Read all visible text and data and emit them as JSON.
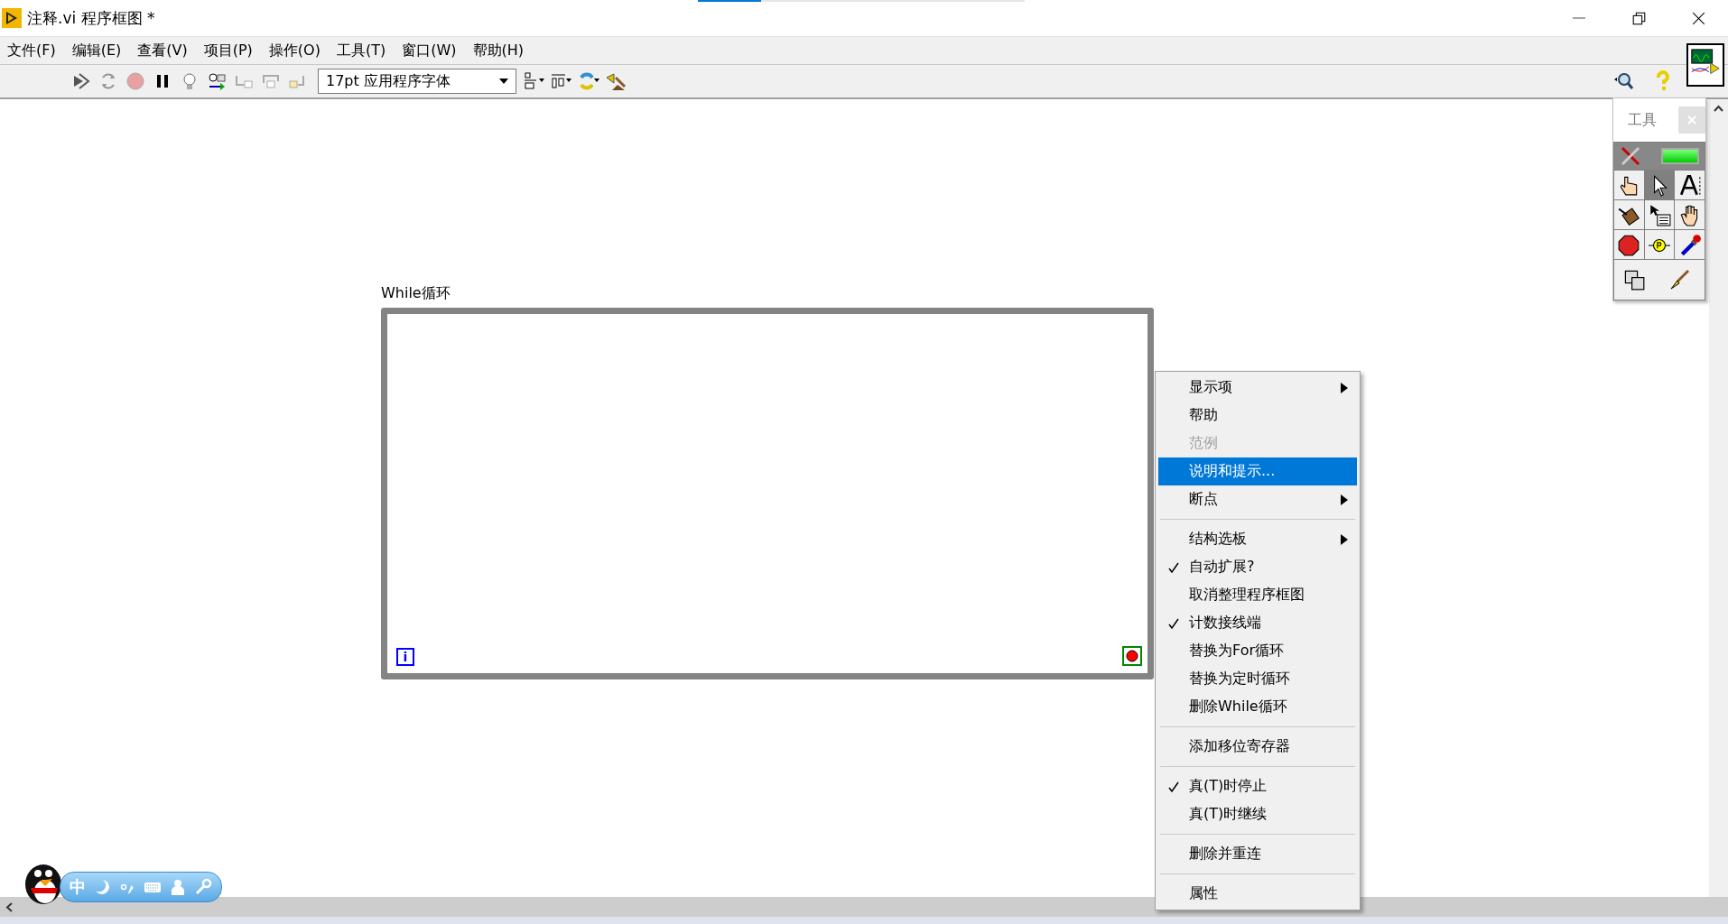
{
  "window": {
    "title": "注释.vi 程序框图 *"
  },
  "menu_bar": [
    "文件(F)",
    "编辑(E)",
    "查看(V)",
    "项目(P)",
    "操作(O)",
    "工具(T)",
    "窗口(W)",
    "帮助(H)"
  ],
  "toolbar": {
    "font": "17pt 应用程序字体"
  },
  "diagram": {
    "loop_label": "While循环",
    "iteration_terminal": "i"
  },
  "context_menu": {
    "groups": [
      [
        {
          "label": "显示项",
          "kind": "submenu",
          "checked": false,
          "disabled": false,
          "selected": false
        },
        {
          "label": "帮助",
          "kind": "command",
          "checked": false,
          "disabled": false,
          "selected": false
        },
        {
          "label": "范例",
          "kind": "command",
          "checked": false,
          "disabled": true,
          "selected": false
        },
        {
          "label": "说明和提示...",
          "kind": "command",
          "checked": false,
          "disabled": false,
          "selected": true
        },
        {
          "label": "断点",
          "kind": "submenu",
          "checked": false,
          "disabled": false,
          "selected": false
        }
      ],
      [
        {
          "label": "结构选板",
          "kind": "submenu",
          "checked": false,
          "disabled": false,
          "selected": false
        },
        {
          "label": "自动扩展?",
          "kind": "command",
          "checked": true,
          "disabled": false,
          "selected": false
        },
        {
          "label": "取消整理程序框图",
          "kind": "command",
          "checked": false,
          "disabled": false,
          "selected": false
        },
        {
          "label": "计数接线端",
          "kind": "command",
          "checked": true,
          "disabled": false,
          "selected": false
        },
        {
          "label": "替换为For循环",
          "kind": "command",
          "checked": false,
          "disabled": false,
          "selected": false
        },
        {
          "label": "替换为定时循环",
          "kind": "command",
          "checked": false,
          "disabled": false,
          "selected": false
        },
        {
          "label": "删除While循环",
          "kind": "command",
          "checked": false,
          "disabled": false,
          "selected": false
        }
      ],
      [
        {
          "label": "添加移位寄存器",
          "kind": "command",
          "checked": false,
          "disabled": false,
          "selected": false
        }
      ],
      [
        {
          "label": "真(T)时停止",
          "kind": "command",
          "checked": true,
          "disabled": false,
          "selected": false
        },
        {
          "label": "真(T)时继续",
          "kind": "command",
          "checked": false,
          "disabled": false,
          "selected": false
        }
      ],
      [
        {
          "label": "删除并重连",
          "kind": "command",
          "checked": false,
          "disabled": false,
          "selected": false
        }
      ],
      [
        {
          "label": "属性",
          "kind": "command",
          "checked": false,
          "disabled": false,
          "selected": false
        }
      ]
    ]
  },
  "tools_palette": {
    "title": "工具",
    "auto_tool": {
      "on": true
    },
    "tools": [
      {
        "kind": "operate",
        "selected": false
      },
      {
        "kind": "position",
        "selected": true
      },
      {
        "kind": "text",
        "selected": false
      },
      {
        "kind": "wire",
        "selected": false
      },
      {
        "kind": "shortcut",
        "selected": false
      },
      {
        "kind": "scroll",
        "selected": false
      },
      {
        "kind": "breakpoint",
        "selected": false
      },
      {
        "kind": "probe",
        "selected": false
      },
      {
        "kind": "color-copy",
        "selected": false
      }
    ]
  },
  "ime_bar": {
    "mode": "中"
  }
}
